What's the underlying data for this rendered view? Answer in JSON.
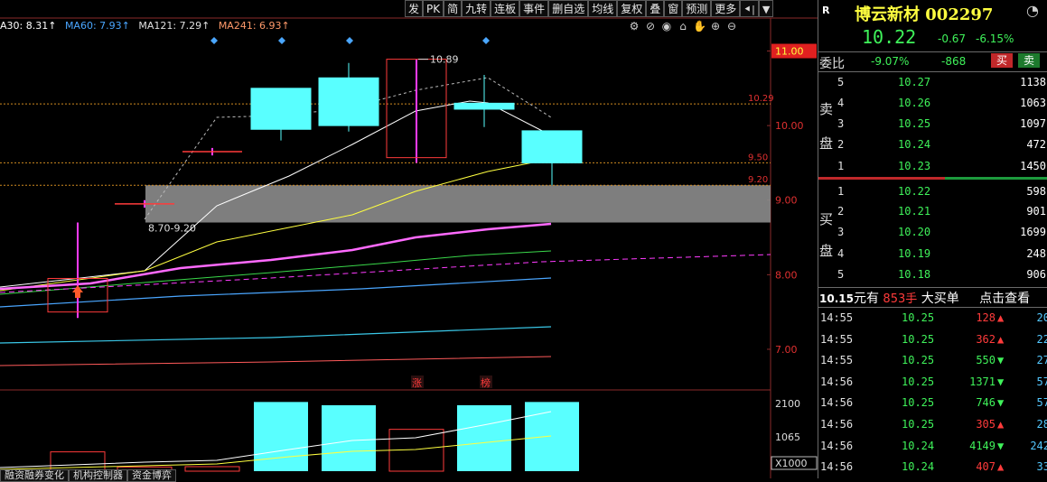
{
  "toolbar": [
    {
      "name": "toolbar-fa",
      "label": "发"
    },
    {
      "name": "toolbar-pk",
      "label": "PK"
    },
    {
      "name": "toolbar-jian",
      "label": "简"
    },
    {
      "name": "toolbar-jiuzhuan",
      "label": "九转"
    },
    {
      "name": "toolbar-lianban",
      "label": "连板"
    },
    {
      "name": "toolbar-shijian",
      "label": "事件"
    },
    {
      "name": "toolbar-shanzixuan",
      "label": "删自选"
    },
    {
      "name": "toolbar-junxian",
      "label": "均线"
    },
    {
      "name": "toolbar-fuquan",
      "label": "复权"
    },
    {
      "name": "toolbar-die",
      "label": "叠"
    },
    {
      "name": "toolbar-chuang",
      "label": "窗"
    },
    {
      "name": "toolbar-yuce",
      "label": "预测"
    },
    {
      "name": "toolbar-gengduo",
      "label": "更多"
    }
  ],
  "ma_legend": {
    "ma30": "A30: 8.31↑",
    "ma60": "MA60: 7.93↑",
    "ma121": "MA121: 7.29↑",
    "ma241": "MA241: 6.93↑"
  },
  "colors": {
    "up": "#ff3b3b",
    "down": "#3ff25a",
    "cyan": "#59ffff",
    "magenta": "#ff3bff",
    "ma_blue": "#4aa6ff",
    "ma_yellow": "#ffff40"
  },
  "price_axis": {
    "labels": [
      "11.00",
      "10.00",
      "9.00",
      "8.00",
      "7.00"
    ],
    "level_labels": [
      "10.29",
      "9.50",
      "9.20"
    ],
    "range_label": "8.70-9.20",
    "high_label": "10.89"
  },
  "markers": {
    "zhang": "涨",
    "bang": "榜"
  },
  "volume_axis": {
    "labels": [
      "2100",
      "1065"
    ],
    "unit": "X1000"
  },
  "chart_data": {
    "type": "candlestick",
    "ylim": [
      6.6,
      11.2
    ],
    "candles": [
      {
        "o": 7.5,
        "h": 8.7,
        "l": 7.42,
        "c": 7.95,
        "up": true
      },
      {
        "o": 8.9,
        "h": 9.0,
        "l": 8.9,
        "c": 8.95,
        "up": true
      },
      {
        "o": 9.6,
        "h": 9.7,
        "l": 9.6,
        "c": 9.65,
        "up": true
      },
      {
        "o": 9.95,
        "h": 10.5,
        "l": 9.8,
        "c": 10.5,
        "up": true,
        "fill": "cyan"
      },
      {
        "o": 10.0,
        "h": 10.84,
        "l": 9.92,
        "c": 10.64,
        "up": true,
        "fill": "cyan"
      },
      {
        "o": 9.57,
        "h": 10.89,
        "l": 9.5,
        "c": 10.89,
        "up": true,
        "hollow": true
      },
      {
        "o": 10.3,
        "h": 10.68,
        "l": 9.98,
        "c": 10.22,
        "up": false,
        "fill": "cyan"
      },
      {
        "o": 9.93,
        "h": 9.93,
        "l": 9.2,
        "c": 9.5,
        "up": false,
        "fill": "cyan"
      }
    ],
    "volumes": [
      600,
      130,
      140,
      2150,
      2050,
      1300,
      2050,
      2150
    ]
  },
  "stock": {
    "tag": "R",
    "name": "博云新材 002297",
    "price": "10.22",
    "change": "-0.67",
    "change_pct": "-6.15%",
    "weibi_label": "委比",
    "weibi_pct": "-9.07%",
    "weibi_vol": "-868",
    "buy_btn": "买",
    "sell_btn": "卖"
  },
  "sell_side": {
    "label1": "卖",
    "label2": "盘"
  },
  "buy_side": {
    "label1": "买",
    "label2": "盘"
  },
  "sell_orders": [
    {
      "level": "5",
      "price": "10.27",
      "vol": "1138"
    },
    {
      "level": "4",
      "price": "10.26",
      "vol": "1063"
    },
    {
      "level": "3",
      "price": "10.25",
      "vol": "1097"
    },
    {
      "level": "2",
      "price": "10.24",
      "vol": "472"
    },
    {
      "level": "1",
      "price": "10.23",
      "vol": "1450"
    }
  ],
  "buy_orders": [
    {
      "level": "1",
      "price": "10.22",
      "vol": "598"
    },
    {
      "level": "2",
      "price": "10.21",
      "vol": "901"
    },
    {
      "level": "3",
      "price": "10.20",
      "vol": "1699"
    },
    {
      "level": "4",
      "price": "10.19",
      "vol": "248"
    },
    {
      "level": "5",
      "price": "10.18",
      "vol": "906"
    }
  ],
  "big_order": {
    "price": "10.15",
    "price_unit": "元有",
    "vol": "853手",
    "desc": "大买单",
    "link": "点击查看"
  },
  "ticks": [
    {
      "time": "14:55",
      "price": "10.25",
      "vol": "128",
      "dir": "up",
      "num": "20"
    },
    {
      "time": "14:55",
      "price": "10.25",
      "vol": "362",
      "dir": "up",
      "num": "22"
    },
    {
      "time": "14:55",
      "price": "10.25",
      "vol": "550",
      "dir": "down",
      "num": "27"
    },
    {
      "time": "14:56",
      "price": "10.25",
      "vol": "1371",
      "dir": "down",
      "num": "57"
    },
    {
      "time": "14:56",
      "price": "10.25",
      "vol": "746",
      "dir": "down",
      "num": "57"
    },
    {
      "time": "14:56",
      "price": "10.25",
      "vol": "305",
      "dir": "up",
      "num": "28"
    },
    {
      "time": "14:56",
      "price": "10.24",
      "vol": "4149",
      "dir": "down",
      "num": "242"
    },
    {
      "time": "14:56",
      "price": "10.24",
      "vol": "407",
      "dir": "up",
      "num": "33"
    }
  ],
  "bottom_tabs": [
    "融资融券变化",
    "机构控制器",
    "资金博弈"
  ]
}
